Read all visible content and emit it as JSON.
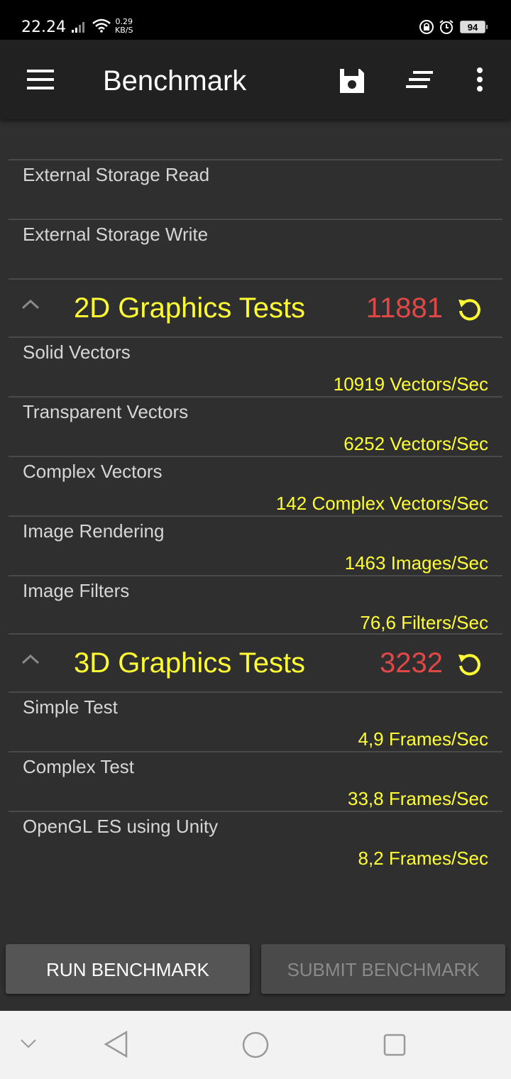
{
  "status": {
    "time": "22.24",
    "speed_value": "0.29",
    "speed_unit": "KB/S",
    "battery": "94"
  },
  "toolbar": {
    "title": "Benchmark",
    "menu_icon": "hamburger-menu-icon",
    "save_icon": "floppy-save-icon",
    "sort_icon": "sort-lines-icon",
    "more_icon": "more-vert-icon"
  },
  "storage_rows": [
    {
      "label": "External Storage Read"
    },
    {
      "label": "External Storage Write"
    }
  ],
  "sections": [
    {
      "title": "2D Graphics Tests",
      "score": "11881",
      "rows": [
        {
          "label": "Solid Vectors",
          "value": "10919 Vectors/Sec"
        },
        {
          "label": "Transparent Vectors",
          "value": "6252 Vectors/Sec"
        },
        {
          "label": "Complex Vectors",
          "value": "142 Complex Vectors/Sec"
        },
        {
          "label": "Image Rendering",
          "value": "1463 Images/Sec"
        },
        {
          "label": "Image Filters",
          "value": "76,6 Filters/Sec"
        }
      ]
    },
    {
      "title": "3D Graphics Tests",
      "score": "3232",
      "rows": [
        {
          "label": "Simple Test",
          "value": "4,9 Frames/Sec"
        },
        {
          "label": "Complex Test",
          "value": "33,8 Frames/Sec"
        },
        {
          "label": "OpenGL ES using Unity",
          "value": "8,2 Frames/Sec"
        }
      ]
    }
  ],
  "buttons": {
    "run": "RUN BENCHMARK",
    "submit": "SUBMIT BENCHMARK"
  },
  "colors": {
    "value": "#ffff33",
    "score": "#e04848",
    "background": "#2f2f2f",
    "toolbar": "#212121"
  }
}
